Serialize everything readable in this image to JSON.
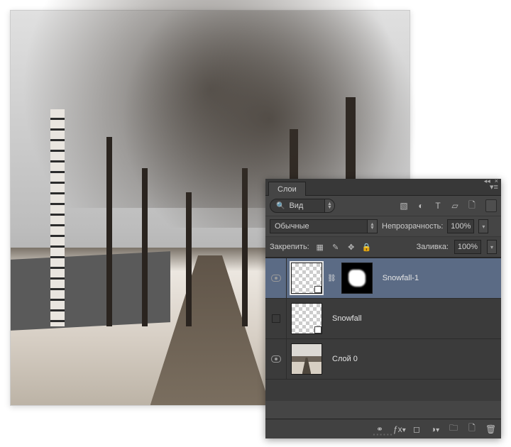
{
  "panel": {
    "tab_label": "Слои",
    "search_label": "Вид",
    "filter_icons": [
      "image-icon",
      "adjust-icon",
      "type-icon",
      "shape-icon",
      "smartobj-icon"
    ],
    "blend_mode": "Обычные",
    "opacity_label": "Непрозрачность:",
    "opacity_value": "100%",
    "lock_label": "Закрепить:",
    "fill_label": "Заливка:",
    "fill_value": "100%"
  },
  "layers": [
    {
      "name": "Snowfall-1",
      "visible": true,
      "selected": true,
      "has_mask": true,
      "thumb": "checker"
    },
    {
      "name": "Snowfall",
      "visible": false,
      "selected": false,
      "has_mask": false,
      "thumb": "checker"
    },
    {
      "name": "Слой 0",
      "visible": true,
      "selected": false,
      "has_mask": false,
      "thumb": "photo"
    }
  ],
  "footer_icons": [
    "link-icon",
    "fx-icon",
    "mask-icon",
    "adjustment-icon",
    "group-icon",
    "new-layer-icon",
    "trash-icon"
  ]
}
